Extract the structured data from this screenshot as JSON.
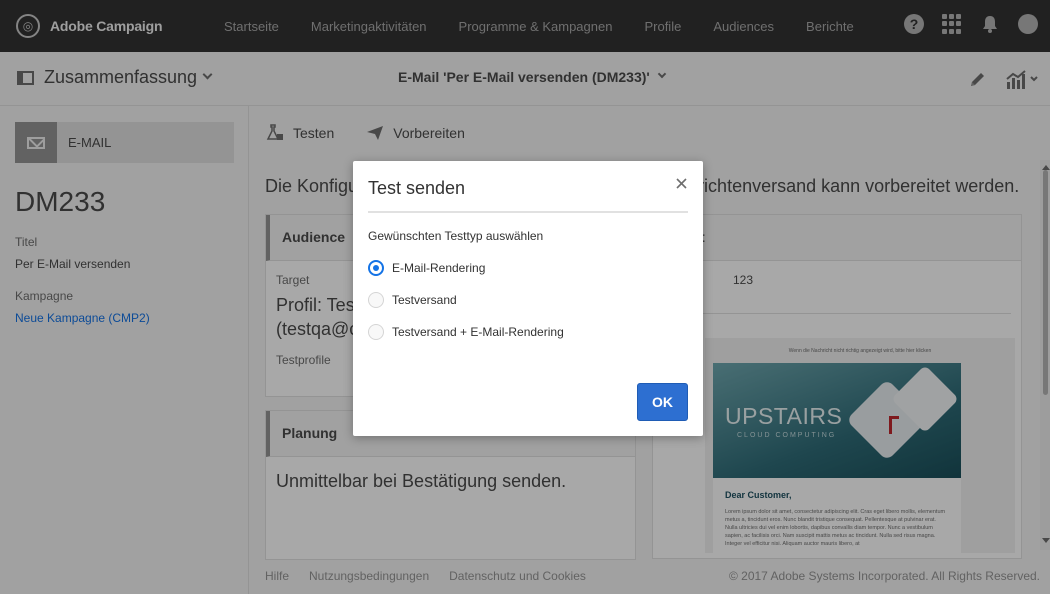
{
  "app": {
    "name": "Adobe Campaign"
  },
  "nav": {
    "items": [
      "Startseite",
      "Marketingaktivitäten",
      "Programme & Kampagnen",
      "Profile",
      "Audiences",
      "Berichte"
    ]
  },
  "top_icons": {
    "help": "?",
    "grid": "apps-grid-icon",
    "bell": "bell-icon",
    "avatar": "avatar-icon"
  },
  "subheader": {
    "summary_label": "Zusammenfassung",
    "document_title": "E-Mail 'Per E-Mail versenden (DM233)'"
  },
  "sidebar": {
    "chip_label": "E-MAIL",
    "code": "DM233",
    "title_label": "Titel",
    "title_value": "Per E-Mail versenden",
    "campaign_label": "Kampagne",
    "campaign_value": "Neue Kampagne (CMP2)"
  },
  "toolbar": {
    "test_label": "Testen",
    "prepare_label": "Vorbereiten"
  },
  "main": {
    "intro_left": "Die Konfigu",
    "intro_right": "richtenversand kann vorbereitet werden.",
    "audience_card": {
      "title": "Audience",
      "target_label": "Target",
      "profile_line1": "Profil: Test",
      "profile_line2": "(testqa@c",
      "testprofile": "Testprofile"
    },
    "content_card": {
      "title_partial": "t",
      "value": "123"
    },
    "planning_card": {
      "title": "Planung",
      "text": "Unmittelbar bei Bestätigung senden."
    },
    "preview": {
      "top_line": "Wenn die Nachricht nicht richtig angezeigt wird, bitte hier klicken",
      "brand": "UPSTAIRS",
      "tagline": "CLOUD COMPUTING",
      "greeting": "Dear Customer,",
      "body": "Lorem ipsum dolor sit amet, consectetur adipiscing elit. Cras eget libero mollis, elementum metus a, tincidunt eros. Nunc blandit tristique consequat. Pellentesque at pulvinar erat. Nulla ultricies dui vel enim lobortis, dapibus convallis diam tempor. Nunc a vestibulum sapien, ac facilisis orci. Nam suscipit mattis metus ac tincidunt. Nulla sed risus magna. Integer vel efficitur nisi. Aliquam auctor mauris libero, at"
    }
  },
  "footer": {
    "links": [
      "Hilfe",
      "Nutzungsbedingungen",
      "Datenschutz und Cookies"
    ],
    "copyright": "© 2017 Adobe Systems Incorporated. All Rights Reserved."
  },
  "dialog": {
    "title": "Test senden",
    "subtitle": "Gewünschten Testtyp auswählen",
    "options": [
      {
        "label": "E-Mail-Rendering",
        "selected": true
      },
      {
        "label": "Testversand",
        "selected": false
      },
      {
        "label": "Testversand + E-Mail-Rendering",
        "selected": false
      }
    ],
    "ok_label": "OK"
  },
  "colors": {
    "topbar": "#323232",
    "accent": "#2d6fd1",
    "link": "#1473e6"
  }
}
